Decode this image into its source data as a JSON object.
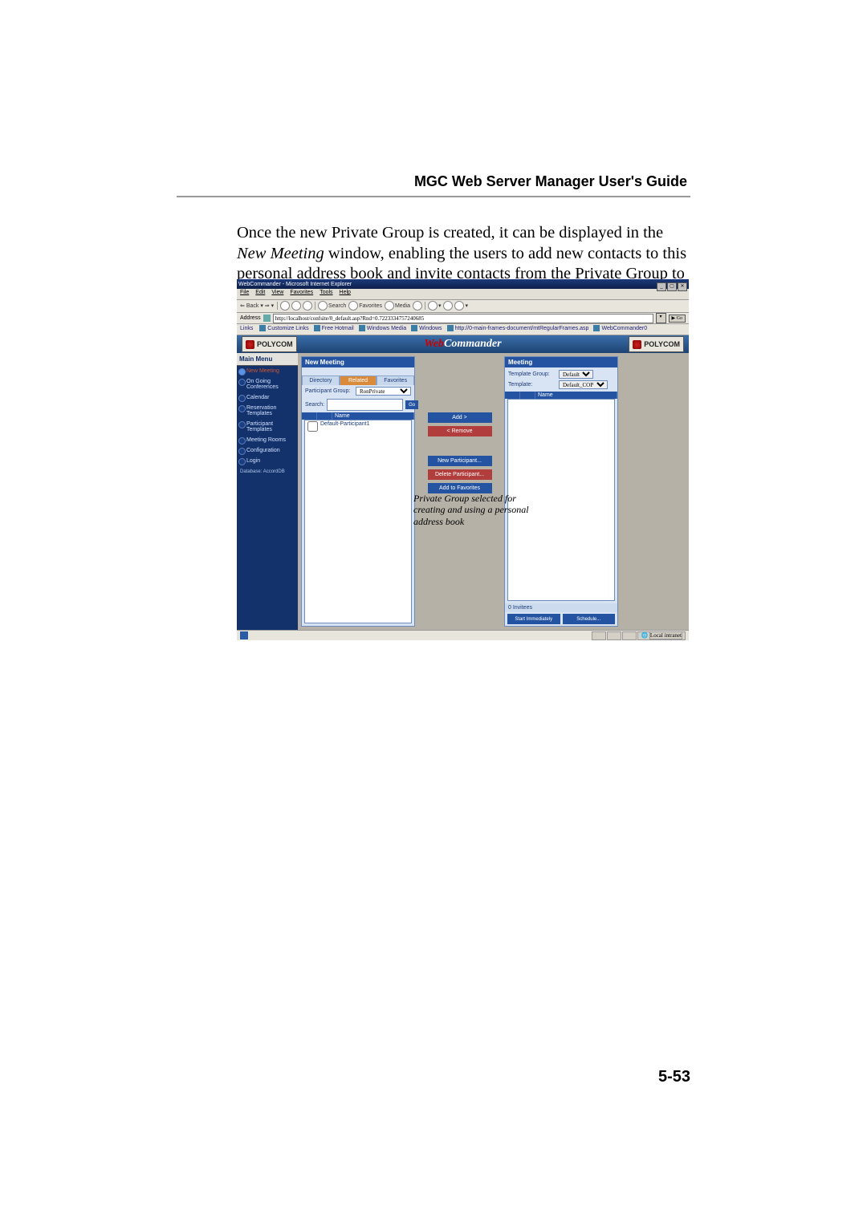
{
  "header_title": "MGC Web Server Manager User's Guide",
  "paragraph_parts": {
    "p1": "Once the new Private Group is created, it can be displayed in the ",
    "p2": "New Meeting",
    "p3": " window, enabling the users to add new contacts to this personal address book and invite contacts from the Private Group to the new meeting."
  },
  "page_number": "5-53",
  "browser": {
    "title": "WebCommander - Microsoft Internet Explorer",
    "menus": [
      "File",
      "Edit",
      "View",
      "Favorites",
      "Tools",
      "Help"
    ],
    "toolbar_items": [
      "Back",
      " ▾ ",
      " ",
      " ",
      "Search",
      "Favorites",
      "Media"
    ],
    "address_label": "Address",
    "address_value": "http://localhost/confsite/0_default.asp?Rnd=0.7223334757240685",
    "go_label": "Go",
    "links_label": "Links",
    "links": [
      "Customize Links",
      "Free Hotmail",
      "Windows Media",
      "Windows",
      "http://0-main-frames-document/mtRegularFrames.asp",
      "WebCommander0"
    ],
    "brand": "POLYCOM",
    "app_title_web": "Web",
    "app_title_cmd": "Commander",
    "status_zone": "Local intranet"
  },
  "sidebar": {
    "heading": "Main Menu",
    "items": [
      {
        "label": "New Meeting",
        "active": true
      },
      {
        "label": "On Going Conferences",
        "active": false
      },
      {
        "label": "Calendar",
        "active": false
      },
      {
        "label": "Reservation Templates",
        "active": false
      },
      {
        "label": "Participant Templates",
        "active": false
      },
      {
        "label": "Meeting Rooms",
        "active": false
      },
      {
        "label": "Configuration",
        "active": false
      },
      {
        "label": "Login",
        "active": false
      }
    ],
    "db_label": "Database: AccordDB"
  },
  "left_panel": {
    "heading": "New Meeting",
    "tabs": [
      "Directory",
      "Related",
      "Favorites"
    ],
    "active_tab": 1,
    "pg_label": "Participant Group:",
    "pg_value": "RonPrivate",
    "search_label": "Search:",
    "go": "Go",
    "thead_cols": [
      "",
      "",
      "Name"
    ],
    "rows": [
      "Default-Participant1"
    ]
  },
  "mid_buttons": {
    "add": "Add >",
    "remove": "< Remove",
    "newp": "New Participant...",
    "delp": "Delete Participant...",
    "addfav": "Add to Favorites"
  },
  "callout": "Private Group selected for creating and using a personal address book",
  "right_panel": {
    "heading": "Meeting",
    "tg_label": "Template Group:",
    "tg_value": "Default",
    "tmpl_label": "Template:",
    "tmpl_value": "Default_COP",
    "thead_cols": [
      "",
      "",
      "Name"
    ],
    "invitees": "0 Invitees",
    "start": "Start Immediately",
    "schedule": "Schedule..."
  }
}
